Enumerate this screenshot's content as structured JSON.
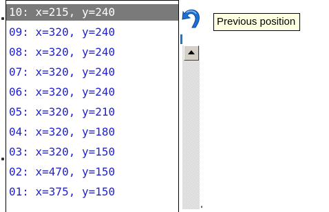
{
  "history": {
    "items": [
      {
        "label": "10: x=215, y=240",
        "selected": true
      },
      {
        "label": "09: x=320, y=240",
        "selected": false
      },
      {
        "label": "08: x=320, y=240",
        "selected": false
      },
      {
        "label": "07: x=320, y=240",
        "selected": false
      },
      {
        "label": "06: x=320, y=240",
        "selected": false
      },
      {
        "label": "05: x=320, y=210",
        "selected": false
      },
      {
        "label": "04: x=320, y=180",
        "selected": false
      },
      {
        "label": "03: x=320, y=150",
        "selected": false
      },
      {
        "label": "02: x=470, y=150",
        "selected": false
      },
      {
        "label": "01: x=375, y=150",
        "selected": false
      }
    ]
  },
  "tooltip": {
    "text": "Previous position"
  },
  "icons": {
    "undo": "undo-arrow-icon",
    "scroll_up": "arrow-up-icon"
  },
  "colors": {
    "item_text": "#2020d0",
    "selected_bg": "#7a7a7a",
    "tooltip_bg": "#ffffe1",
    "undo_blue": "#1e6fd0"
  }
}
